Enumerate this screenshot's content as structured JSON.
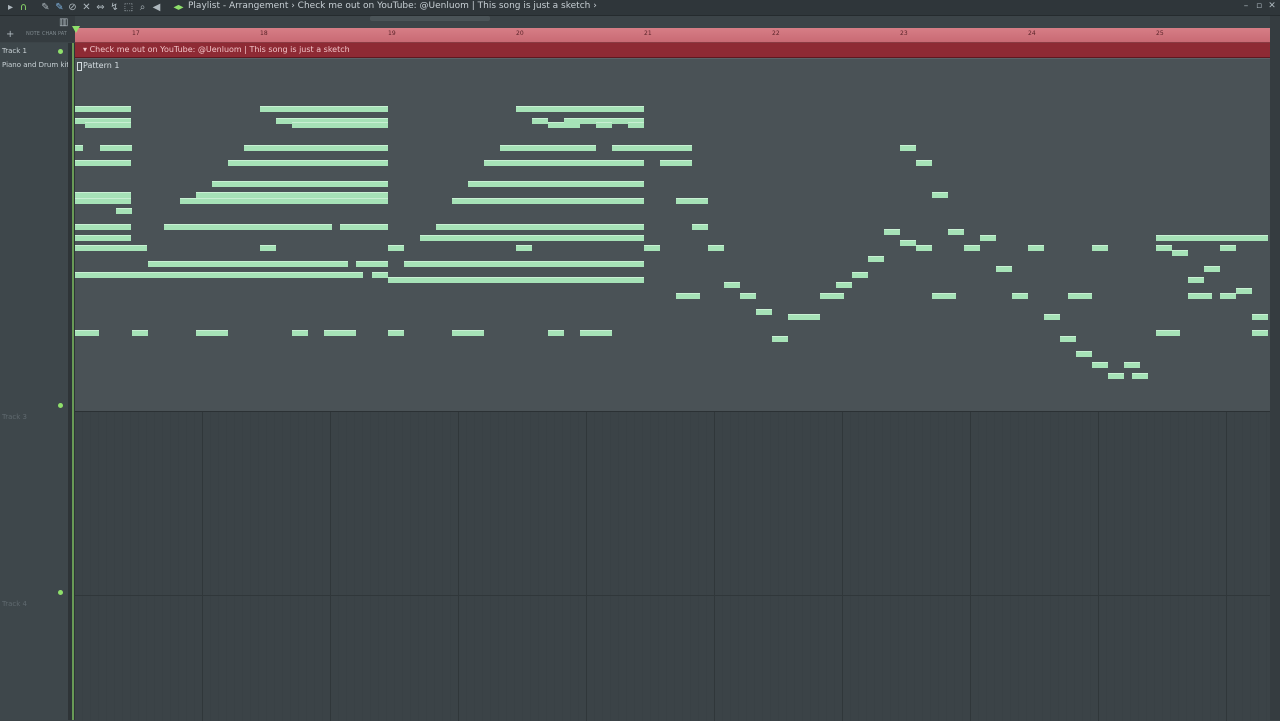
{
  "window": {
    "title": "Playlist - Arrangement › Check me out on YouTube: @Uenluom | This song is just a sketch ›"
  },
  "toolbar_icons": [
    "arrow-icon",
    "magnet-icon",
    "pencil-icon",
    "brush-icon",
    "delete-icon",
    "mute-icon",
    "slip-icon",
    "slice-icon",
    "select-icon",
    "zoom-icon",
    "playback-icon",
    "play-icon"
  ],
  "left_panel": {
    "add_label": "+",
    "mini_tabs": [
      "NOTE",
      "CHAN",
      "PAT"
    ]
  },
  "timeline": {
    "bar_numbers": [
      "17",
      "18",
      "19",
      "20",
      "21",
      "22",
      "23",
      "24",
      "25"
    ]
  },
  "tracks": [
    {
      "label": "Track 1"
    },
    {
      "label": "Piano and Drum kit"
    },
    {
      "label": "Track 3"
    },
    {
      "label": "Track 4"
    }
  ],
  "clips": {
    "marker_text": "Check me out on YouTube: @Uenluom | This song is just a sketch",
    "pattern_label": "Pattern 1"
  },
  "colors": {
    "accent_green": "#8fe06b",
    "note_color": "#a6e2b7",
    "marker_red": "#8e2a34",
    "timeline_red": "#c96a74"
  }
}
